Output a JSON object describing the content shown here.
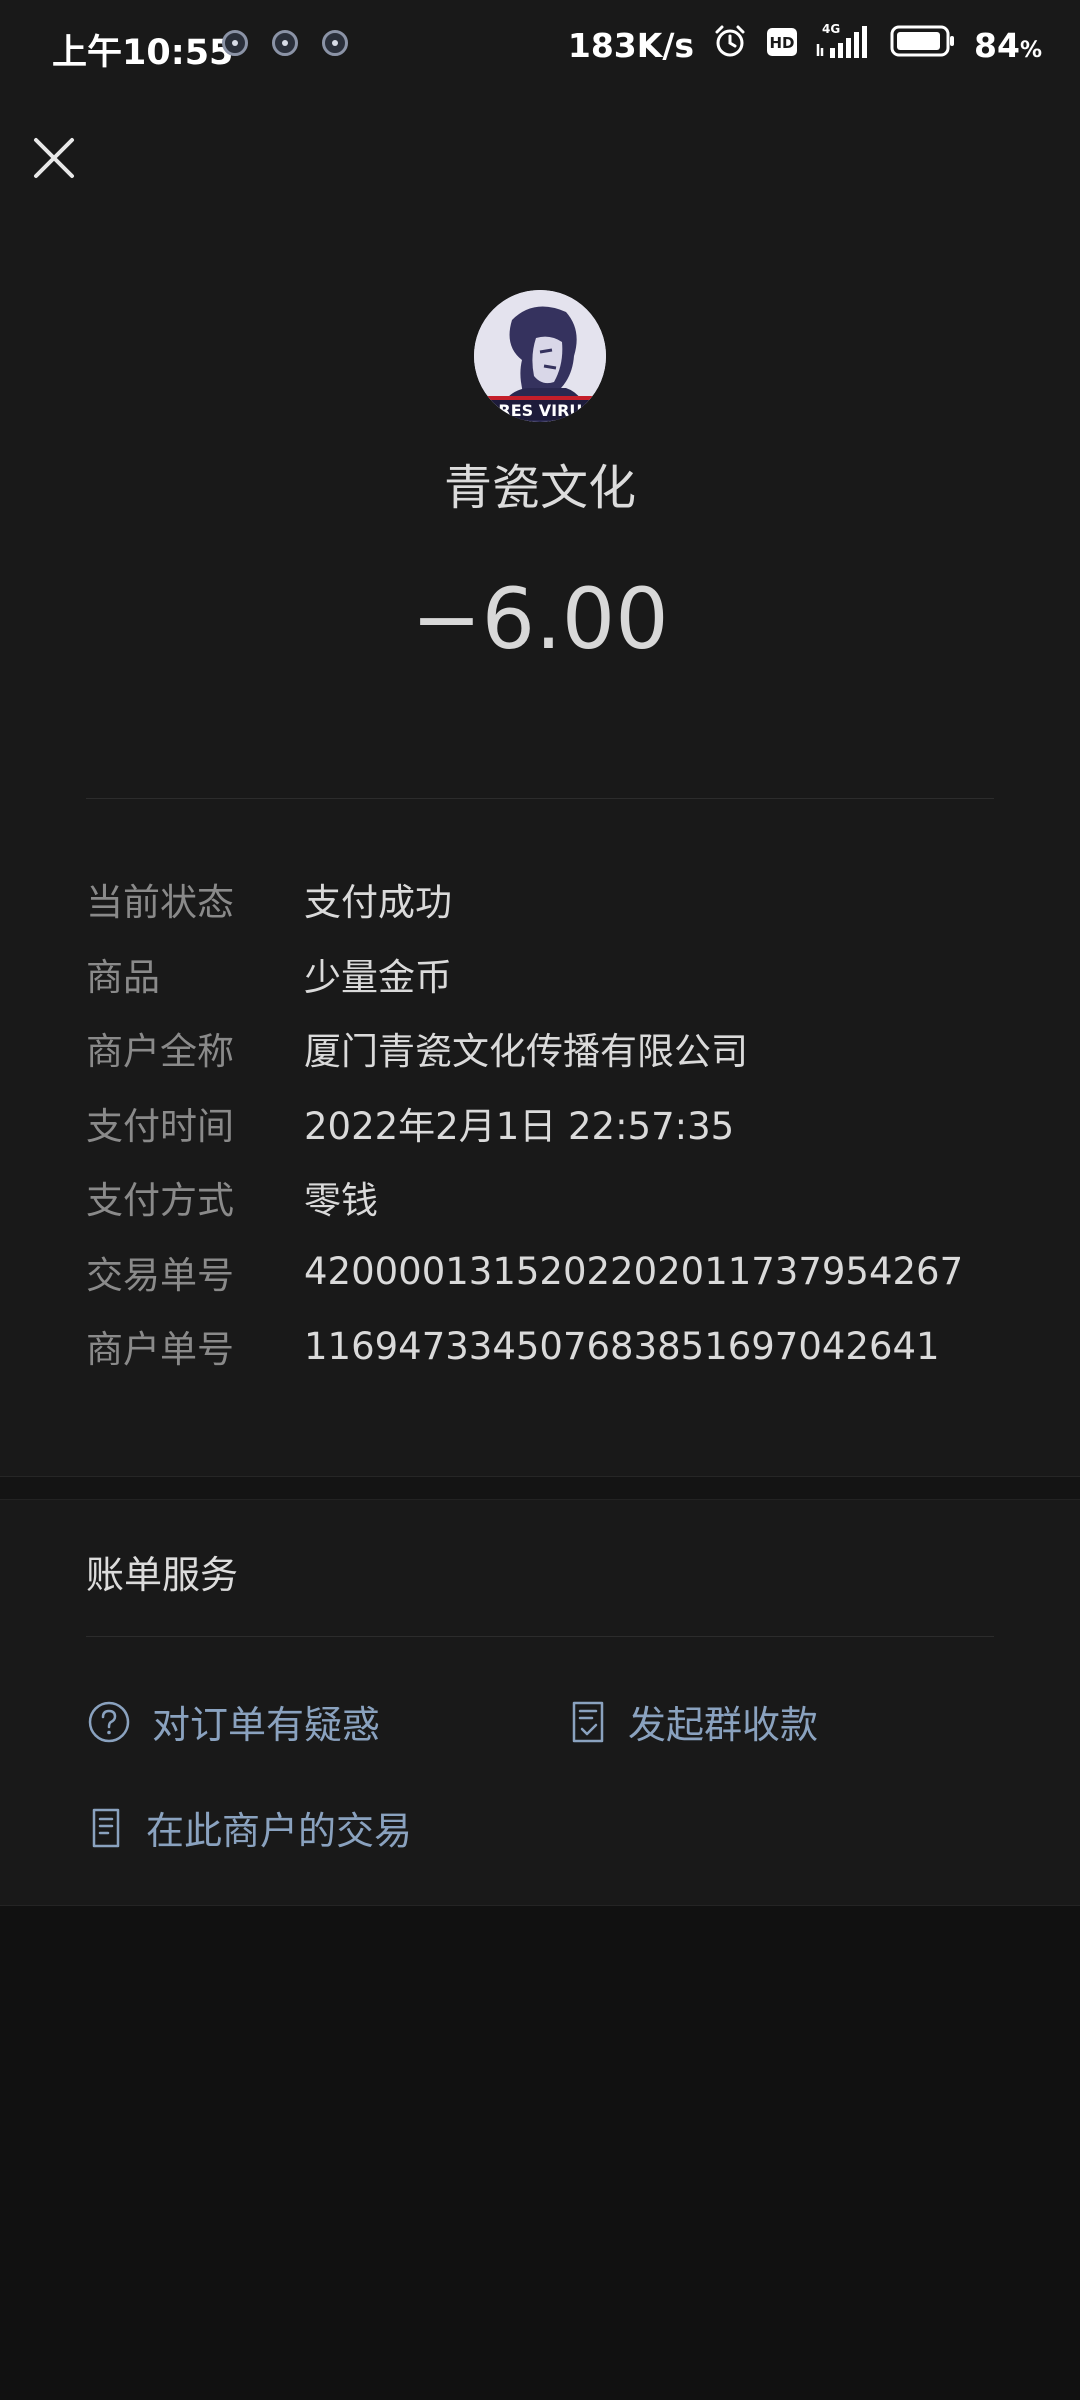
{
  "status_bar": {
    "time": "上午10:55",
    "net_speed": "183K/s",
    "hd_badge": "HD",
    "network": "4G",
    "battery": "84",
    "battery_unit": "%"
  },
  "header": {
    "close_icon": "close-icon",
    "avatar_text": "ARES VIRUS",
    "merchant_name": "青瓷文化",
    "amount": "−6.00"
  },
  "details": [
    {
      "label": "当前状态",
      "value": "支付成功"
    },
    {
      "label": "商品",
      "value": "少量金币"
    },
    {
      "label": "商户全称",
      "value": "厦门青瓷文化传播有限公司"
    },
    {
      "label": "支付时间",
      "value": "2022年2月1日 22:57:35"
    },
    {
      "label": "支付方式",
      "value": "零钱"
    },
    {
      "label": "交易单号",
      "value": "4200001315202202011737954267"
    },
    {
      "label": "商户单号",
      "value": "116947334507683851697042641"
    }
  ],
  "services": {
    "title": "账单服务",
    "links": [
      {
        "label": "对订单有疑惑",
        "icon": "question-circle-icon"
      },
      {
        "label": "发起群收款",
        "icon": "receipt-check-icon"
      },
      {
        "label": "在此商户的交易",
        "icon": "document-icon"
      }
    ]
  },
  "colors": {
    "background": "#191919",
    "link": "#8aa2bf",
    "label": "#8a8a8a"
  }
}
